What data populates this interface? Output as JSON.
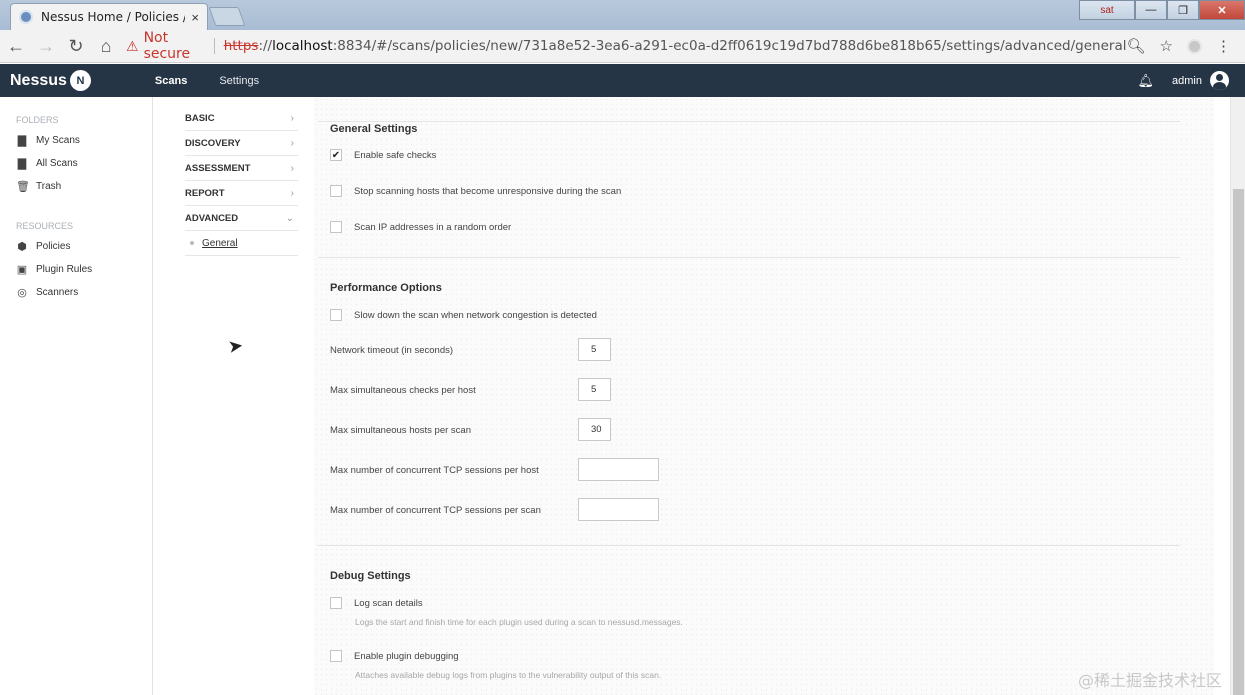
{
  "browser": {
    "tab_title": "Nessus Home / Policies /",
    "tab_close": "×",
    "window_user": "sat",
    "window_buttons": [
      "—",
      "❐",
      "✕"
    ],
    "not_secure": "Not secure",
    "url_scheme": "https",
    "url_sep": "://",
    "url_host": "localhost",
    "url_rest": ":8834/#/scans/policies/new/731a8e52-3ea6-a291-ec0a-d2ff0619c19d7bd788d6be818b65/settings/advanced/general"
  },
  "app": {
    "logo": "Nessus",
    "logo_badge": "N",
    "nav": [
      "Scans",
      "Settings"
    ],
    "user": "admin"
  },
  "sidebar": {
    "folders_heading": "FOLDERS",
    "folders": [
      {
        "label": "My Scans",
        "icon": "folder-icon"
      },
      {
        "label": "All Scans",
        "icon": "folder-icon"
      },
      {
        "label": "Trash",
        "icon": "trash-icon"
      }
    ],
    "resources_heading": "RESOURCES",
    "resources": [
      {
        "label": "Policies",
        "icon": "shield-icon"
      },
      {
        "label": "Plugin Rules",
        "icon": "plugin-rules-icon"
      },
      {
        "label": "Scanners",
        "icon": "scanner-icon"
      }
    ]
  },
  "settings_nav": {
    "items": [
      "BASIC",
      "DISCOVERY",
      "ASSESSMENT",
      "REPORT",
      "ADVANCED"
    ],
    "sub_item": "General"
  },
  "general_settings": {
    "title": "General Settings",
    "options": [
      {
        "label": "Enable safe checks",
        "checked": true
      },
      {
        "label": "Stop scanning hosts that become unresponsive during the scan",
        "checked": false
      },
      {
        "label": "Scan IP addresses in a random order",
        "checked": false
      }
    ]
  },
  "performance": {
    "title": "Performance Options",
    "slow_down": {
      "label": "Slow down the scan when network congestion is detected",
      "checked": false
    },
    "fields": [
      {
        "label": "Network timeout (in seconds)",
        "value": "5"
      },
      {
        "label": "Max simultaneous checks per host",
        "value": "5"
      },
      {
        "label": "Max simultaneous hosts per scan",
        "value": "30"
      },
      {
        "label": "Max number of concurrent TCP sessions per host",
        "value": ""
      },
      {
        "label": "Max number of concurrent TCP sessions per scan",
        "value": ""
      }
    ]
  },
  "debug": {
    "title": "Debug Settings",
    "options": [
      {
        "label": "Log scan details",
        "help": "Logs the start and finish time for each plugin used during a scan to nessusd.messages.",
        "checked": false
      },
      {
        "label": "Enable plugin debugging",
        "help": "Attaches available debug logs from plugins to the vulnerability output of this scan.",
        "checked": false
      }
    ]
  },
  "watermark": "@稀土掘金技术社区"
}
